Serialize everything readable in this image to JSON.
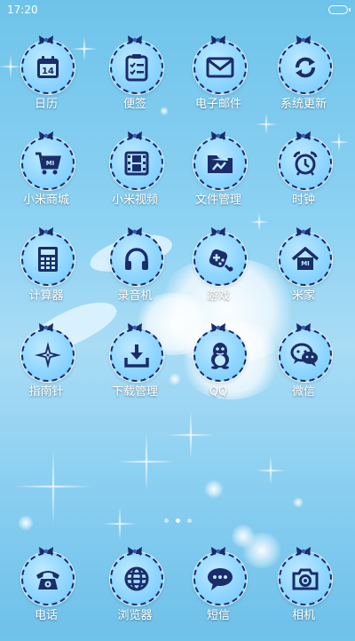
{
  "status_bar": {
    "time": "17:20"
  },
  "colors": {
    "icon_glyph": "#1b2c6a",
    "icon_fill": "#8fd6ff",
    "label": "#ffffff"
  },
  "apps": [
    {
      "label": "日历",
      "icon": "calendar-icon",
      "glyph_text": "14"
    },
    {
      "label": "便签",
      "icon": "notes-icon"
    },
    {
      "label": "电子邮件",
      "icon": "mail-icon"
    },
    {
      "label": "系统更新",
      "icon": "update-icon"
    },
    {
      "label": "小米商城",
      "icon": "cart-icon",
      "glyph_text": "MI"
    },
    {
      "label": "小米视频",
      "icon": "film-icon"
    },
    {
      "label": "文件管理",
      "icon": "folder-icon"
    },
    {
      "label": "时钟",
      "icon": "alarm-clock-icon"
    },
    {
      "label": "计算器",
      "icon": "calculator-icon"
    },
    {
      "label": "录音机",
      "icon": "headphones-icon"
    },
    {
      "label": "游戏",
      "icon": "gamepad-icon"
    },
    {
      "label": "米家",
      "icon": "home-icon",
      "glyph_text": "MI"
    },
    {
      "label": "指南针",
      "icon": "compass-icon"
    },
    {
      "label": "下载管理",
      "icon": "download-icon"
    },
    {
      "label": "QQ",
      "icon": "penguin-icon"
    },
    {
      "label": "微信",
      "icon": "wechat-icon"
    }
  ],
  "dock": [
    {
      "label": "电话",
      "icon": "phone-icon"
    },
    {
      "label": "浏览器",
      "icon": "globe-icon"
    },
    {
      "label": "短信",
      "icon": "message-icon"
    },
    {
      "label": "相机",
      "icon": "camera-icon"
    }
  ],
  "pagination": {
    "current_page": 2,
    "page_count": 3
  }
}
